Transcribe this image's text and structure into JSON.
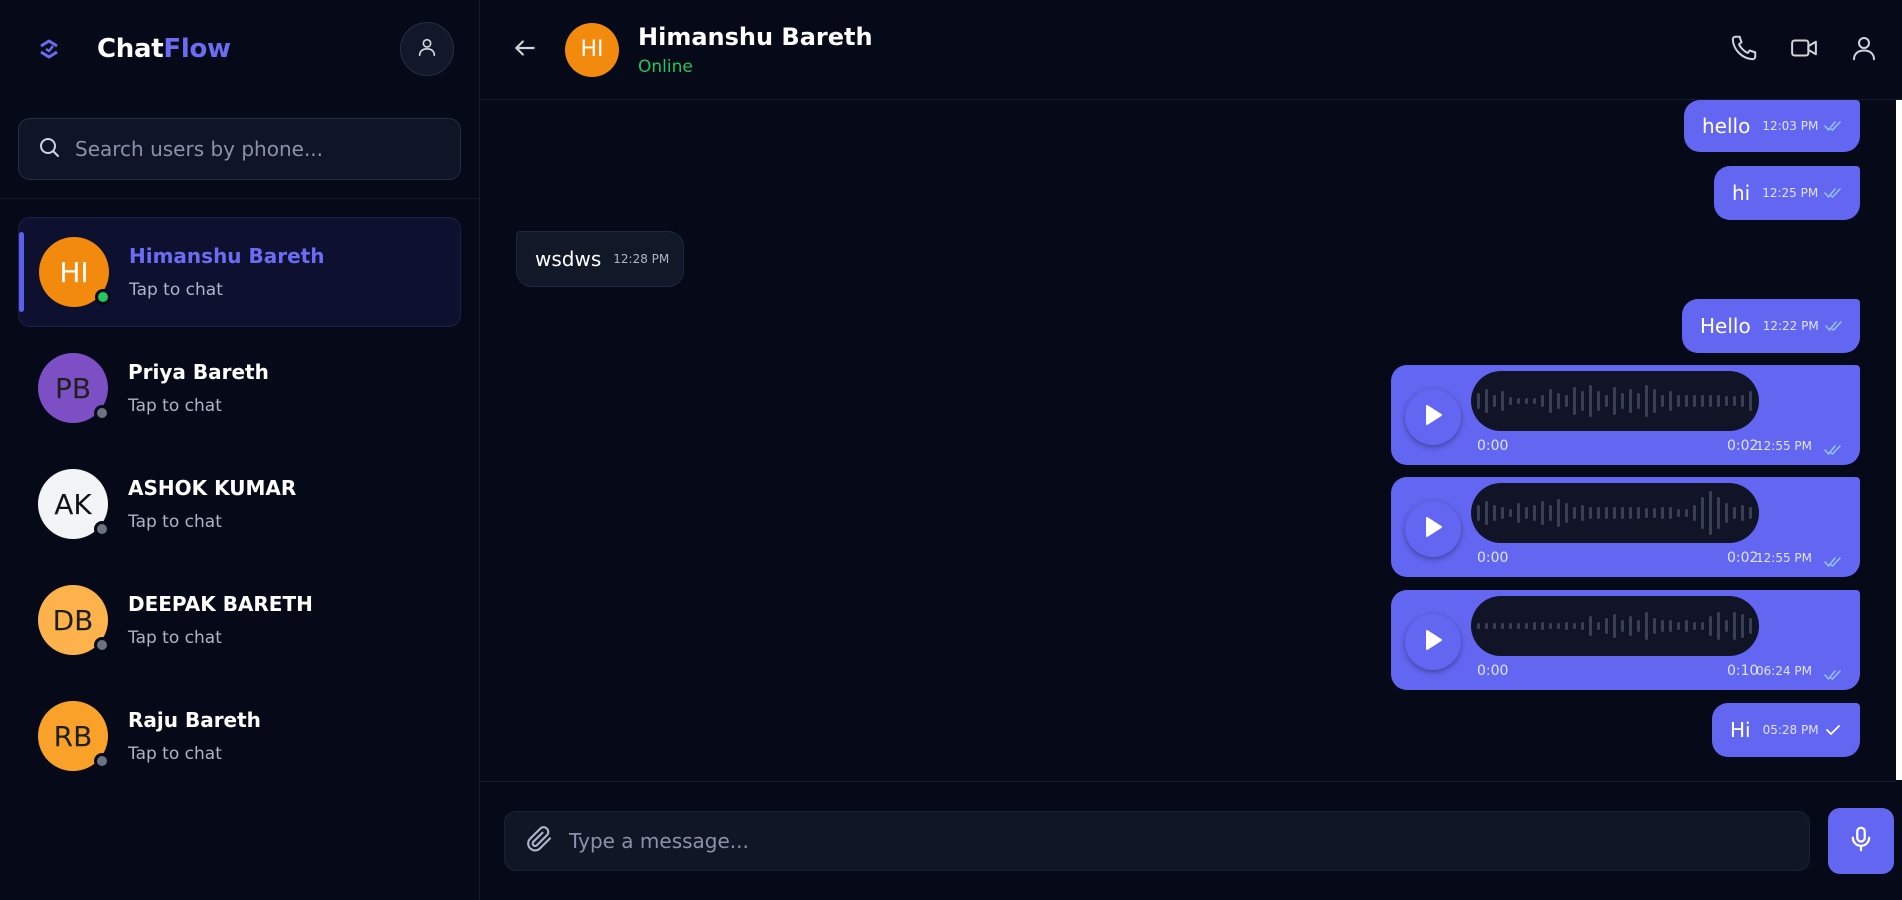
{
  "brand": {
    "name_part1": "Chat",
    "name_part2": "Flow"
  },
  "search": {
    "placeholder": "Search users by phone..."
  },
  "contacts": [
    {
      "initials": "HI",
      "name": "Himanshu Bareth",
      "subtitle": "Tap to chat",
      "avatar_color": "#f28a0e",
      "status": "online",
      "active": true
    },
    {
      "initials": "PB",
      "name": "Priya Bareth",
      "subtitle": "Tap to chat",
      "avatar_color": "#7d4fc4",
      "status": "offline",
      "active": false
    },
    {
      "initials": "AK",
      "name": "ASHOK KUMAR",
      "subtitle": "Tap to chat",
      "avatar_color": "#f3f4f6",
      "status": "offline",
      "active": false
    },
    {
      "initials": "DB",
      "name": "DEEPAK BARETH",
      "subtitle": "Tap to chat",
      "avatar_color": "#fdb24c",
      "status": "offline",
      "active": false
    },
    {
      "initials": "RB",
      "name": "Raju Bareth",
      "subtitle": "Tap to chat",
      "avatar_color": "#f9a128",
      "status": "offline",
      "active": false
    }
  ],
  "chat": {
    "initials": "HI",
    "name": "Himanshu Bareth",
    "status": "Online"
  },
  "messages": [
    {
      "type": "text",
      "dir": "out",
      "text": "hello",
      "time": "12:03 PM",
      "tick": "double"
    },
    {
      "type": "text",
      "dir": "out",
      "text": "hi",
      "time": "12:25 PM",
      "tick": "double"
    },
    {
      "type": "text",
      "dir": "in",
      "text": "wsdws",
      "time": "12:28 PM"
    },
    {
      "type": "text",
      "dir": "out",
      "text": "Hello",
      "time": "12:22 PM",
      "tick": "double"
    },
    {
      "type": "voice",
      "dir": "out",
      "start": "0:00",
      "duration": "0:02",
      "time": "12:55 PM",
      "tick": "double"
    },
    {
      "type": "voice",
      "dir": "out",
      "start": "0:00",
      "duration": "0:02",
      "time": "12:55 PM",
      "tick": "double"
    },
    {
      "type": "voice",
      "dir": "out",
      "start": "0:00",
      "duration": "0:10",
      "time": "06:24 PM",
      "tick": "double"
    },
    {
      "type": "text",
      "dir": "out",
      "text": "Hi",
      "time": "05:28 PM",
      "tick": "single"
    }
  ],
  "composer": {
    "placeholder": "Type a message..."
  },
  "colors": {
    "accent": "#6366f1",
    "online": "#22c55e",
    "offline": "#6b7280",
    "background": "#060918"
  },
  "icons": {
    "logo": "chevrons-logo-icon",
    "profile": "user-icon",
    "search": "search-icon",
    "back": "arrow-left-icon",
    "call": "phone-icon",
    "video": "video-icon",
    "contact_info": "user-icon",
    "attach": "paperclip-icon",
    "mic": "microphone-icon",
    "play": "play-icon",
    "read_receipt": "double-check-icon",
    "sent_receipt": "check-icon"
  }
}
